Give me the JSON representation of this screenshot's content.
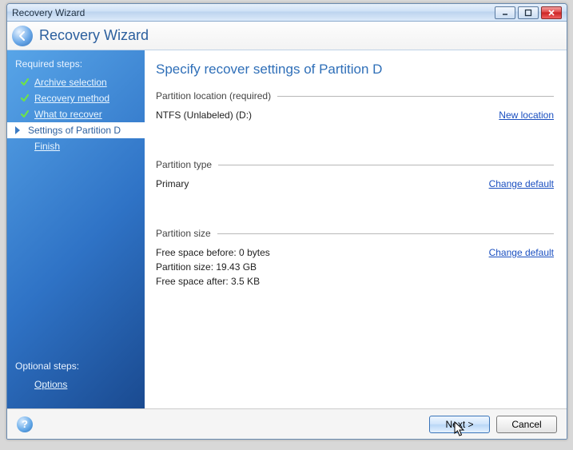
{
  "window": {
    "title": "Recovery Wizard"
  },
  "header": {
    "title": "Recovery Wizard"
  },
  "sidebar": {
    "required_header": "Required steps:",
    "steps": [
      {
        "label": "Archive selection"
      },
      {
        "label": "Recovery method"
      },
      {
        "label": "What to recover"
      },
      {
        "label": "Settings of Partition D"
      },
      {
        "label": "Finish"
      }
    ],
    "optional_header": "Optional steps:",
    "optional": [
      {
        "label": "Options"
      }
    ]
  },
  "main": {
    "heading": "Specify recover settings of Partition D",
    "location": {
      "title": "Partition location (required)",
      "value": "NTFS (Unlabeled) (D:)",
      "link": "New location"
    },
    "ptype": {
      "title": "Partition type",
      "value": "Primary",
      "link": "Change default"
    },
    "psize": {
      "title": "Partition size",
      "free_before": "Free space before: 0 bytes",
      "size": "Partition size: 19.43 GB",
      "free_after": "Free space after: 3.5 KB",
      "link": "Change default"
    }
  },
  "footer": {
    "next": "Next >",
    "cancel": "Cancel"
  }
}
